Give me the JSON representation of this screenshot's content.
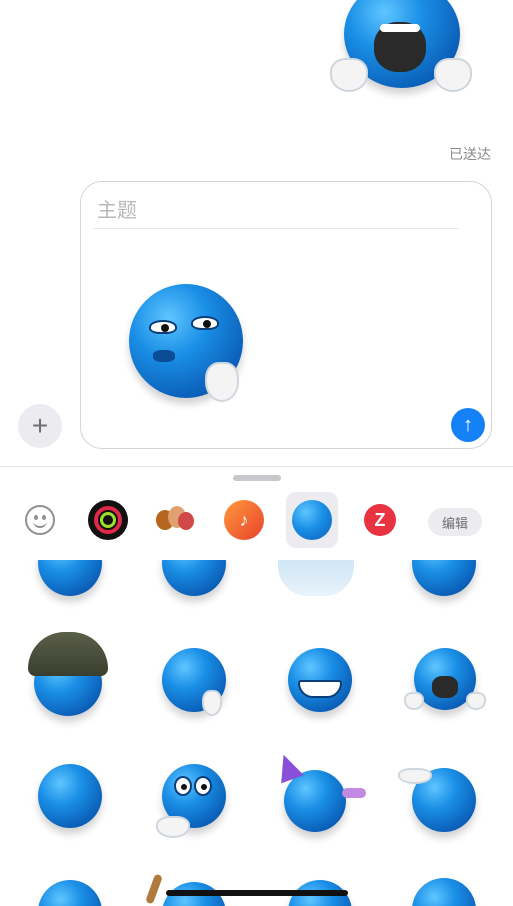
{
  "status": {
    "sent_label": "已送达"
  },
  "compose": {
    "subject_placeholder": "主题"
  },
  "buttons": {
    "plus": "+",
    "send": "↑",
    "edit": "编辑"
  },
  "app_strip": [
    {
      "name": "emoji-keyboard",
      "icon": "smiley-icon"
    },
    {
      "name": "activity",
      "icon": "activity-rings-icon"
    },
    {
      "name": "memoji-stickers",
      "icon": "memoji-icon"
    },
    {
      "name": "garageband",
      "icon": "guitar-icon"
    },
    {
      "name": "blue-emoji-stickers",
      "icon": "blue-emoji-icon",
      "selected": true
    },
    {
      "name": "red-app",
      "icon": "red-z-icon"
    }
  ],
  "colors": {
    "accent": "#1581f6",
    "sticker_blue": "#1a8fe6"
  }
}
